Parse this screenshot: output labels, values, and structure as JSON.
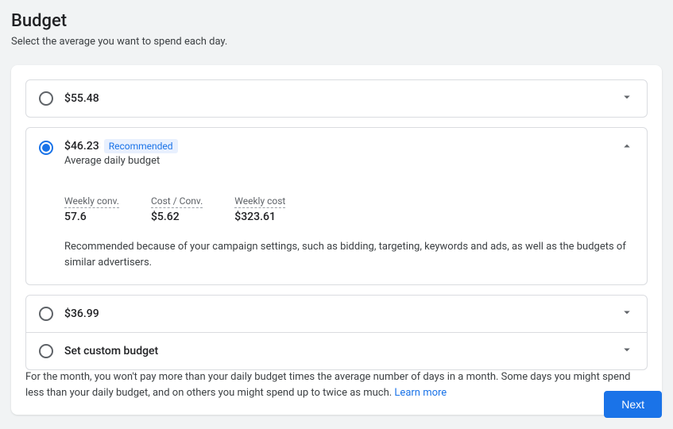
{
  "header": {
    "title": "Budget",
    "subtitle": "Select the average you want to spend each day."
  },
  "options": {
    "opt1": {
      "label": "$55.48"
    },
    "opt2": {
      "label": "$46.23",
      "badge": "Recommended",
      "sublabel": "Average daily budget",
      "stats": {
        "weekly_conv_label": "Weekly conv.",
        "weekly_conv_value": "57.6",
        "cost_conv_label": "Cost / Conv.",
        "cost_conv_value": "$5.62",
        "weekly_cost_label": "Weekly cost",
        "weekly_cost_value": "$323.61"
      },
      "reason": "Recommended because of your campaign settings, such as bidding, targeting, keywords and ads, as well as the budgets of similar advertisers."
    },
    "opt3": {
      "label": "$36.99"
    },
    "opt4": {
      "label": "Set custom budget"
    }
  },
  "footer": {
    "note": "For the month, you won't pay more than your daily budget times the average number of days in a month. Some days you might spend less than your daily budget, and on others you might spend up to twice as much. ",
    "learn_more": "Learn more"
  },
  "actions": {
    "next": "Next"
  }
}
